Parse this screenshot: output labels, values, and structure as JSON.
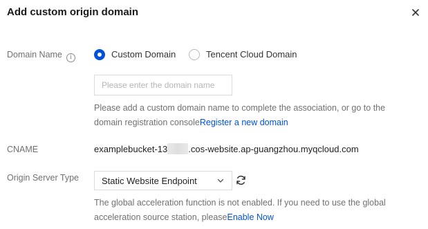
{
  "dialog": {
    "title": "Add custom origin domain",
    "close_icon": "close-icon"
  },
  "domain_name": {
    "label": "Domain Name",
    "info_icon": "info-icon",
    "options": [
      {
        "label": "Custom Domain",
        "checked": true
      },
      {
        "label": "Tencent Cloud Domain",
        "checked": false
      }
    ],
    "input": {
      "value": "",
      "placeholder": "Please enter the domain name"
    },
    "help_line1": "Please add a custom domain name to complete the association, or go to the",
    "help_line2": "domain registration console",
    "help_link": "Register a new domain"
  },
  "cname": {
    "label": "CNAME",
    "value_prefix": "examplebucket-13",
    "value_suffix": ".cos-website.ap-guangzhou.myqcloud.com"
  },
  "origin_server_type": {
    "label": "Origin Server Type",
    "selected": "Static Website Endpoint",
    "refresh_icon": "refresh-icon",
    "chevron_icon": "chevron-down-icon",
    "help_line1": "The global acceleration function is not enabled. If you need to use the global",
    "help_line2": "acceleration source station, please",
    "help_link": "Enable Now"
  },
  "colors": {
    "accent": "#0052d9",
    "label": "#707070",
    "text": "#1f1f1f"
  }
}
